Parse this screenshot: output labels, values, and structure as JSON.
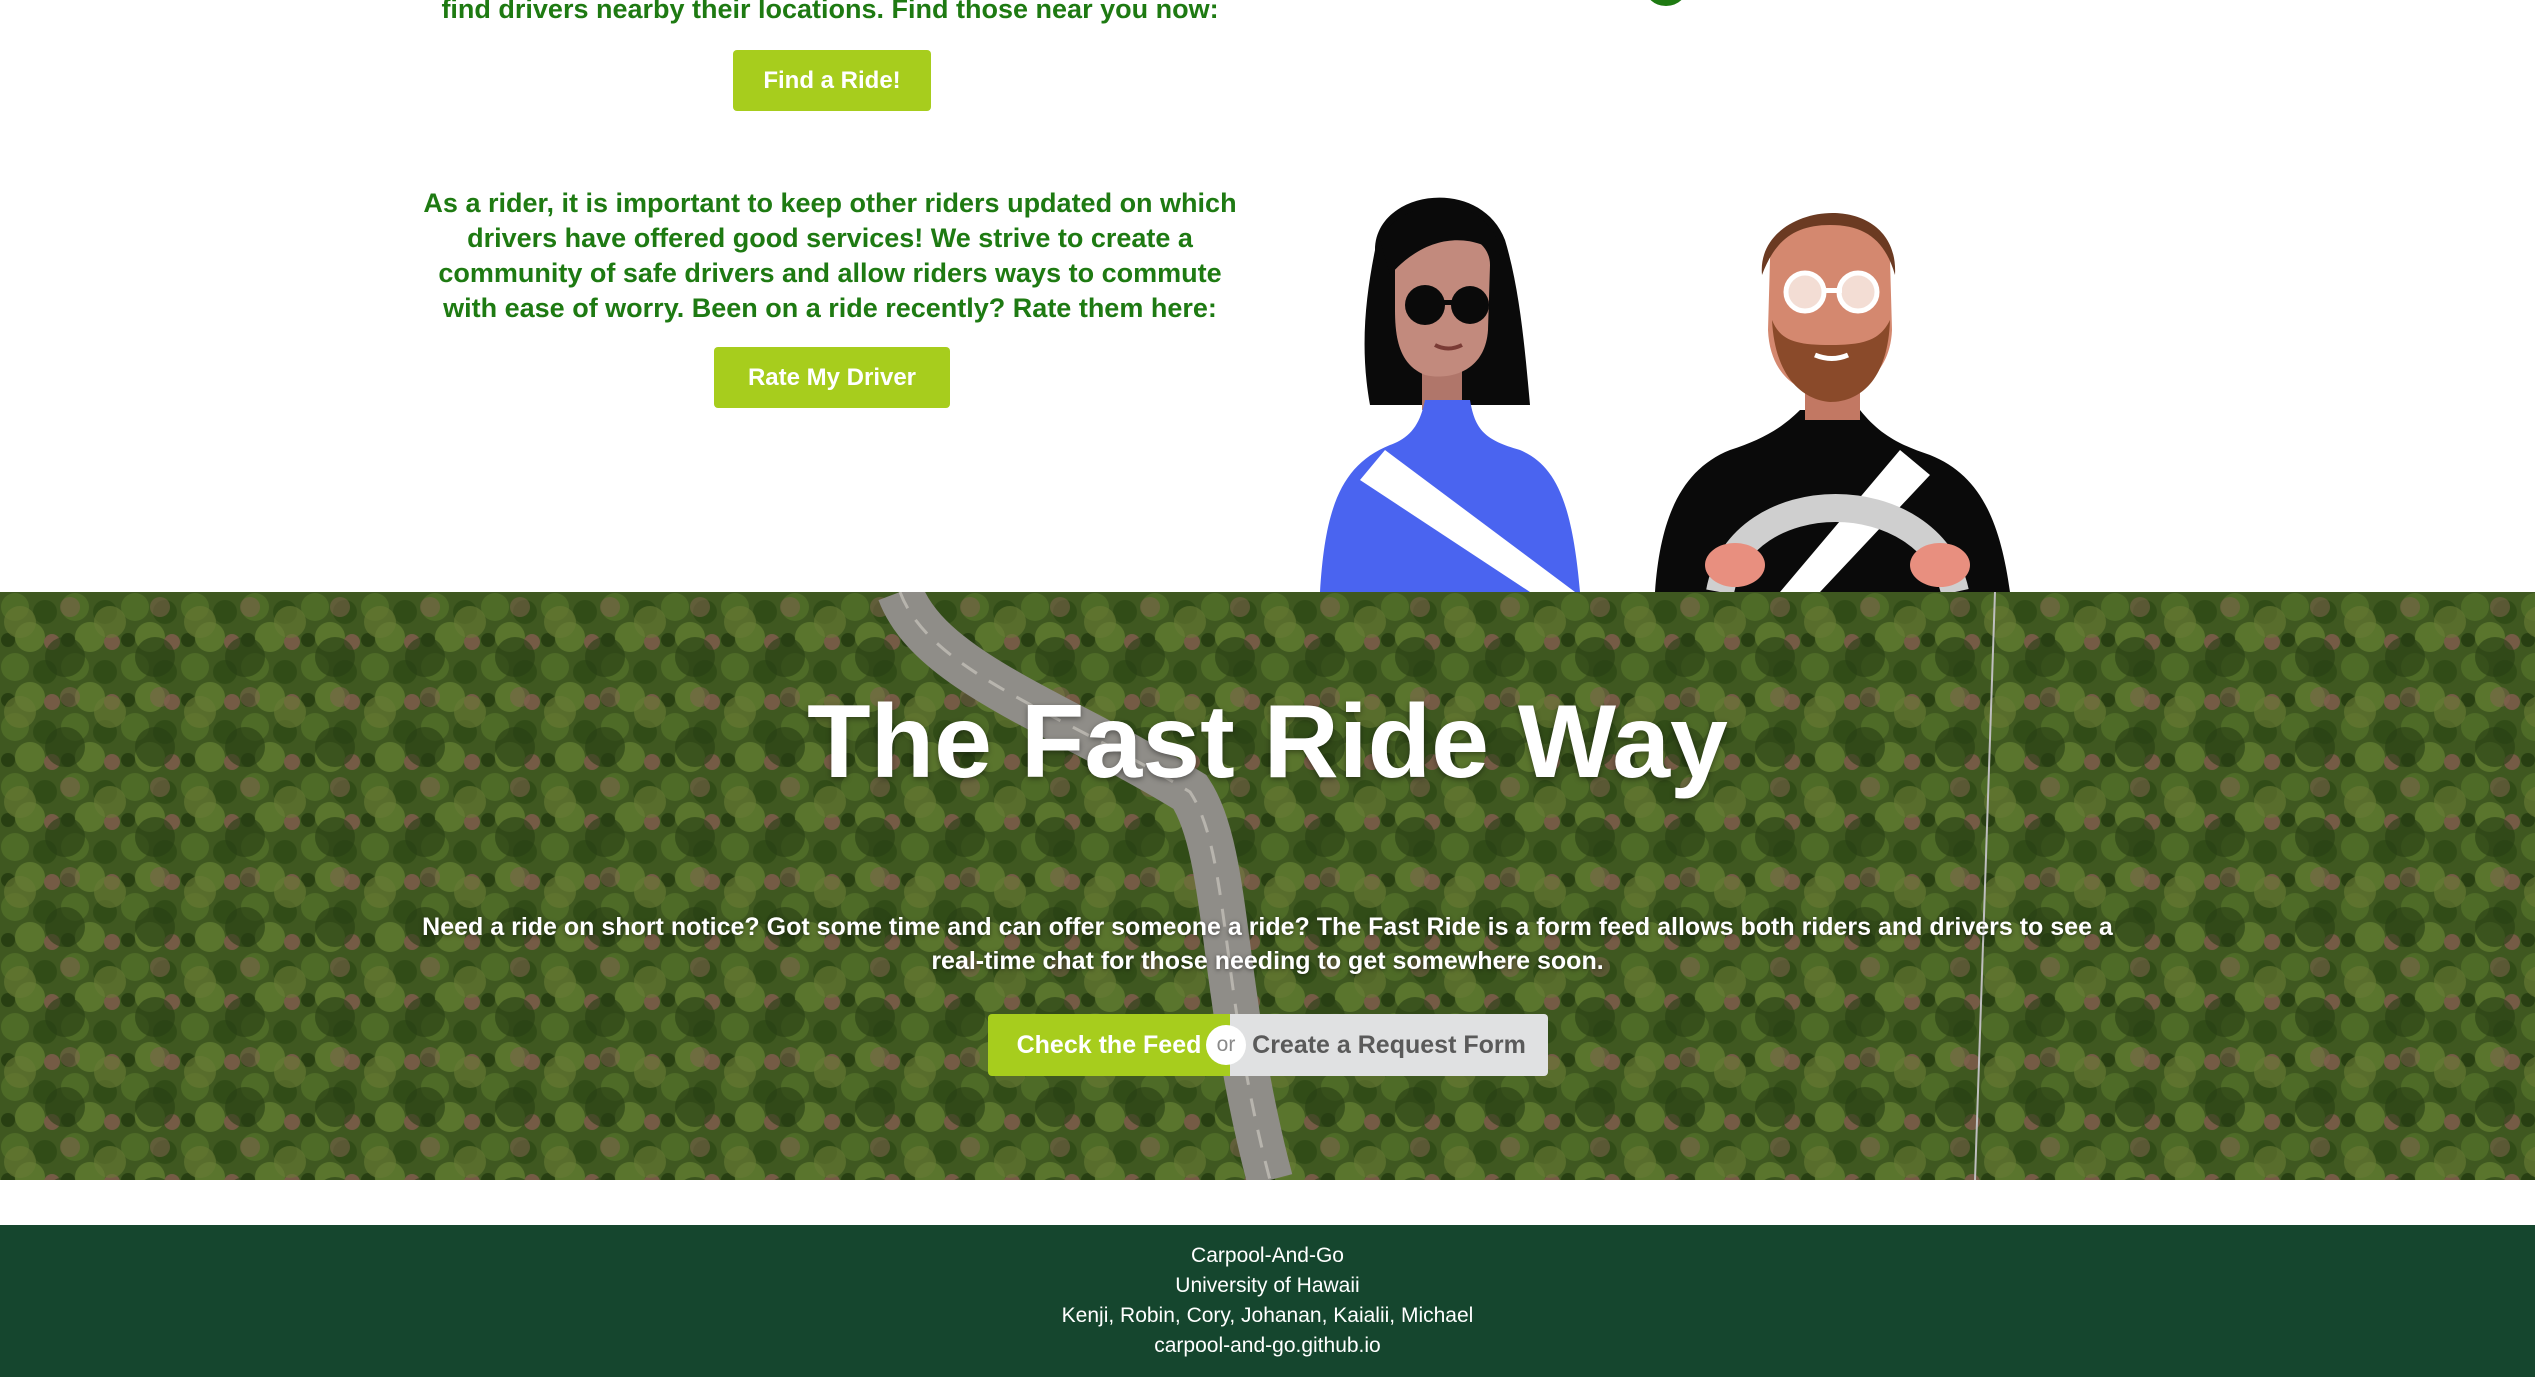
{
  "top": {
    "intro_text": "find drivers nearby their locations. Find those near you now:",
    "find_ride_label": "Find a Ride!",
    "rider_text": "As a rider, it is important to keep other riders updated on which drivers have offered good services! We strive to create a community of safe drivers and allow riders ways to commute with ease of worry. Been on a ride recently? Rate them here:",
    "rate_driver_label": "Rate My Driver"
  },
  "hero": {
    "title": "The Fast Ride Way",
    "description": "Need a ride on short notice? Got some time and can offer someone a ride? The Fast Ride is a form feed allows both riders and drivers to see a real-time chat for those needing to get somewhere soon.",
    "check_feed_label": "Check the Feed",
    "or_label": "or",
    "request_form_label": "Create a Request Form"
  },
  "footer": {
    "line1": "Carpool-And-Go",
    "line2": "University of Hawaii",
    "line3": "Kenji, Robin, Cory, Johanan, Kaialii, Michael",
    "line4": "carpool-and-go.github.io"
  },
  "colors": {
    "accent_green": "#a7cd1d",
    "text_green": "#1e7a12",
    "footer_green": "#15462e",
    "rider_blue": "#4a64f0"
  },
  "icons": {
    "illustration": "carpool-rider-driver-illustration"
  }
}
